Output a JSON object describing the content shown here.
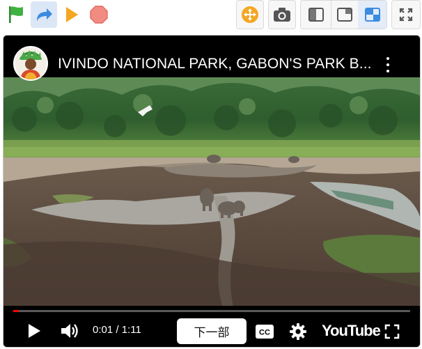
{
  "toolbar": {
    "left_buttons": [
      {
        "icon": "green-flag-icon",
        "color": "#3fb23f"
      },
      {
        "icon": "redo-arrow-icon",
        "color": "#3b8be0"
      },
      {
        "icon": "play-icon",
        "color": "#f5a623"
      },
      {
        "icon": "stop-icon",
        "color": "#f28b82"
      }
    ],
    "right_buttons": [
      {
        "icon": "move-cross-icon",
        "color": "#f5a623"
      },
      {
        "icon": "camera-icon",
        "color": "#555555"
      },
      {
        "icon": "layout-left-panel-icon"
      },
      {
        "icon": "layout-right-panel-icon"
      },
      {
        "icon": "layout-small-stage-icon",
        "color": "#3b8be0"
      },
      {
        "icon": "fullscreen-icon"
      }
    ]
  },
  "player": {
    "title": "IVINDO NATIONAL PARK, GABON'S PARK B...",
    "time_current": "0:01",
    "time_separator": " / ",
    "time_total": "1:11",
    "progress_fraction": 0.014,
    "next_label": "下一部",
    "cc_label": "CC",
    "brand": "YouTube"
  }
}
